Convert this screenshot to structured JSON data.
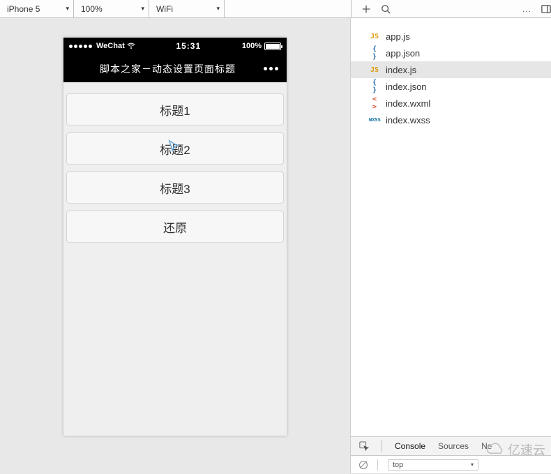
{
  "toolbar": {
    "device": "iPhone 5",
    "zoom": "100%",
    "network": "WiFi",
    "more_label": "..."
  },
  "simulator": {
    "status": {
      "carrier": "WeChat",
      "time": "15:31",
      "battery_pct": "100%"
    },
    "nav_title": "脚本之家－动态设置页面标题",
    "buttons": [
      "标题1",
      "标题2",
      "标题3",
      "还原"
    ]
  },
  "files": {
    "items": [
      {
        "icon": "js",
        "label": "app.js",
        "selected": false
      },
      {
        "icon": "json",
        "label": "app.json",
        "selected": false
      },
      {
        "icon": "js",
        "label": "index.js",
        "selected": true
      },
      {
        "icon": "json",
        "label": "index.json",
        "selected": false
      },
      {
        "icon": "wxml",
        "label": "index.wxml",
        "selected": false
      },
      {
        "icon": "wxss",
        "label": "index.wxss",
        "selected": false
      }
    ]
  },
  "devtools": {
    "tabs": [
      "Console",
      "Sources",
      "Ne"
    ],
    "active_tab": "Console",
    "context": "top"
  },
  "watermark": "亿速云"
}
